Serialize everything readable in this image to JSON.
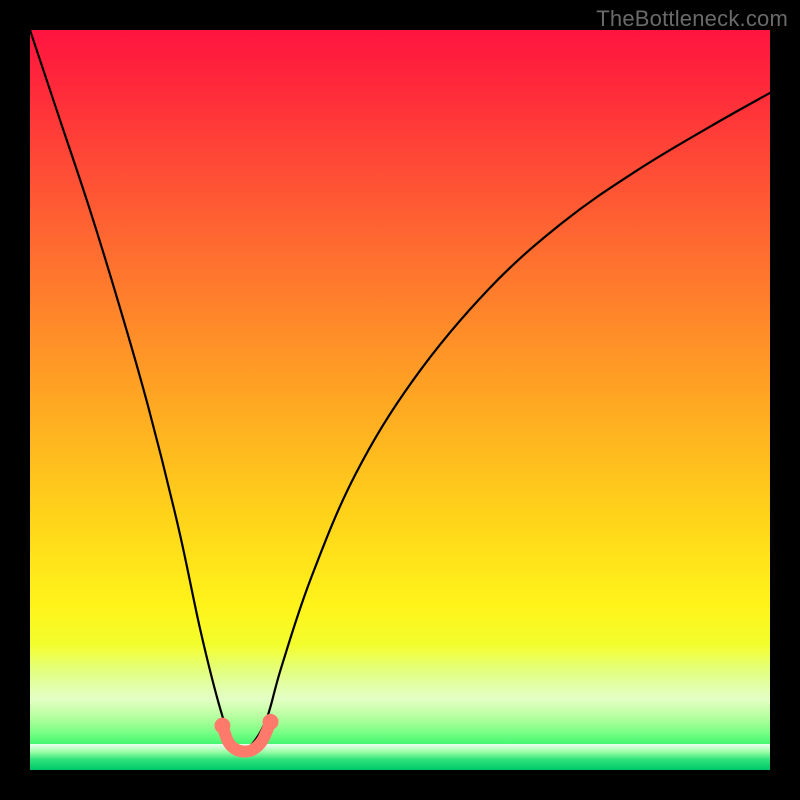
{
  "watermark": {
    "text": "TheBottleneck.com"
  },
  "chart_data": {
    "type": "line",
    "title": "",
    "xlabel": "",
    "ylabel": "",
    "xlim": [
      0,
      1
    ],
    "ylim": [
      0,
      1
    ],
    "grid": false,
    "legend": null,
    "background_gradient": {
      "top": "#ff1440",
      "mid": "#ffd41a",
      "bottom": "#00c86b",
      "direction": "vertical"
    },
    "series": [
      {
        "name": "bottleneck-curve",
        "color": "#000000",
        "x": [
          0.0,
          0.04,
          0.08,
          0.12,
          0.16,
          0.2,
          0.23,
          0.255,
          0.272,
          0.285,
          0.3,
          0.32,
          0.34,
          0.38,
          0.44,
          0.52,
          0.62,
          0.72,
          0.82,
          0.92,
          1.0
        ],
        "values": [
          1.0,
          0.88,
          0.76,
          0.63,
          0.49,
          0.33,
          0.19,
          0.09,
          0.04,
          0.03,
          0.035,
          0.07,
          0.14,
          0.26,
          0.4,
          0.53,
          0.65,
          0.74,
          0.81,
          0.87,
          0.915
        ]
      },
      {
        "name": "bottom-arc",
        "color": "#ff7a6a",
        "x": [
          0.26,
          0.268,
          0.278,
          0.29,
          0.302,
          0.314,
          0.325
        ],
        "values": [
          0.06,
          0.038,
          0.028,
          0.025,
          0.028,
          0.04,
          0.065
        ]
      }
    ],
    "annotations": []
  }
}
